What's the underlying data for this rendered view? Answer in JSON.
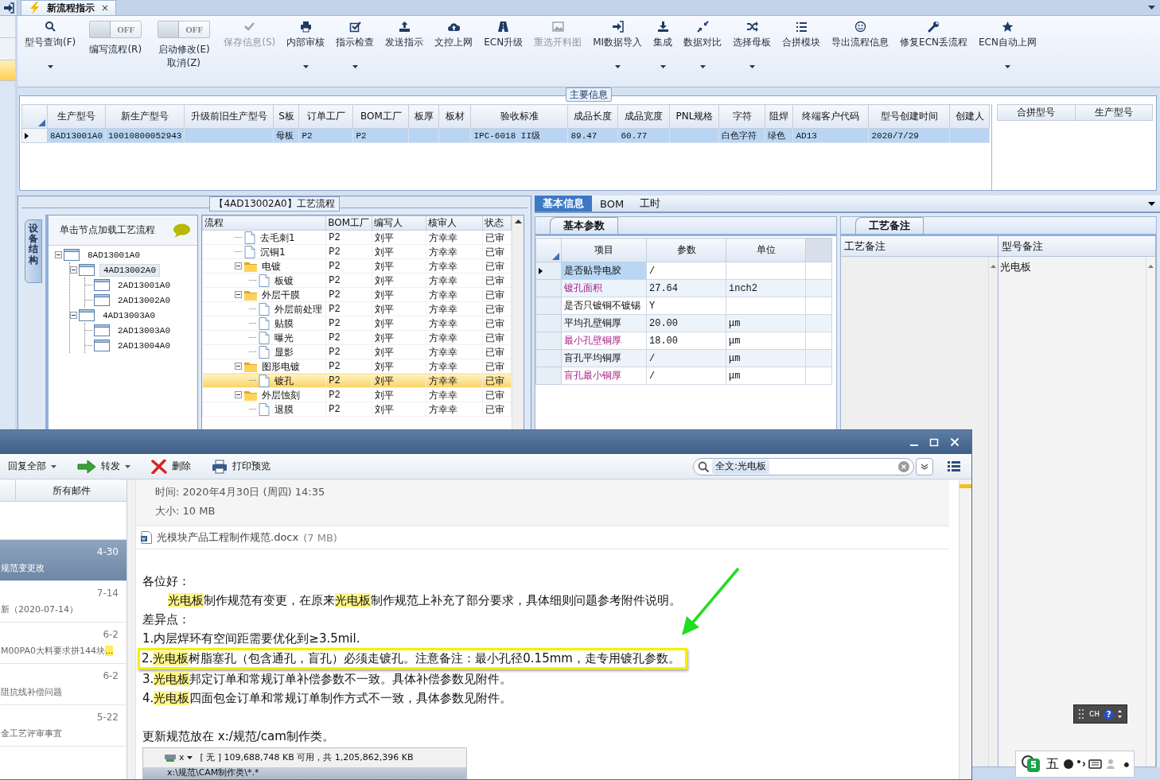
{
  "app": {
    "tab": {
      "title": "新流程指示",
      "close": "×"
    },
    "ribbon": [
      {
        "kind": "button",
        "label": "型号查询(F)",
        "dropdown": true,
        "disabled": false
      },
      {
        "kind": "toggle",
        "label": "编写流程(R)",
        "switch_text": "OFF",
        "on": false
      },
      {
        "kind": "toggle",
        "label": "启动修改(E)",
        "sub": "取消(Z)",
        "switch_text": "OFF",
        "on": false
      },
      {
        "kind": "button",
        "label": "保存信息(S)",
        "dropdown": false,
        "disabled": true
      },
      {
        "kind": "button",
        "label": "内部审核",
        "dropdown": true,
        "disabled": false
      },
      {
        "kind": "button",
        "label": "指示检查",
        "dropdown": true,
        "disabled": false
      },
      {
        "kind": "button",
        "label": "发送指示",
        "dropdown": false,
        "disabled": false
      },
      {
        "kind": "button",
        "label": "文控上网",
        "dropdown": false,
        "disabled": false
      },
      {
        "kind": "button",
        "label": "ECN升级",
        "dropdown": false,
        "disabled": false
      },
      {
        "kind": "button",
        "label": "重选开料图",
        "dropdown": false,
        "disabled": true
      },
      {
        "kind": "button",
        "label": "MI数据导入",
        "dropdown": true,
        "disabled": false
      },
      {
        "kind": "button",
        "label": "集成",
        "dropdown": true,
        "disabled": false
      },
      {
        "kind": "button",
        "label": "数据对比",
        "dropdown": true,
        "disabled": false
      },
      {
        "kind": "button",
        "label": "选择母板",
        "dropdown": true,
        "disabled": false
      },
      {
        "kind": "button",
        "label": "合拼模块",
        "dropdown": false,
        "disabled": false
      },
      {
        "kind": "button",
        "label": "导出流程信息",
        "dropdown": false,
        "disabled": false
      },
      {
        "kind": "button",
        "label": "修复ECN丢流程",
        "dropdown": false,
        "disabled": false
      },
      {
        "kind": "button",
        "label": "ECN自动上网",
        "dropdown": true,
        "disabled": false
      }
    ],
    "main_info": {
      "title": "主要信息",
      "columns": [
        "生产型号",
        "新生产型号",
        "升级前旧生产型号",
        "S板",
        "订单工厂",
        "BOM工厂",
        "板厚",
        "板材",
        "验收标准",
        "成品长度",
        "成品宽度",
        "PNL规格",
        "字符",
        "阻焊",
        "终端客户代码",
        "型号创建时间",
        "创建人"
      ],
      "rows": [
        {
          "selected": true,
          "cells": [
            "8AD13001A0",
            "10010800052943",
            null,
            "母板",
            "P2",
            "P2",
            null,
            null,
            "IPC-6018 II级",
            "89.47",
            "60.77",
            null,
            "白色字符",
            "绿色",
            "AD13",
            "2020/7/29",
            null
          ]
        }
      ],
      "side_columns": [
        "合拼型号",
        "生产型号"
      ]
    },
    "flow_panel": {
      "title": "【4AD13002A0】工艺流程",
      "side_tab": "设备结构",
      "tree_hint": "单击节点加载工艺流程",
      "tree": [
        {
          "label": "8AD13001A0",
          "expanded": true,
          "selected": false,
          "children": [
            {
              "label": "4AD13002A0",
              "expanded": true,
              "selected": true,
              "children": [
                {
                  "label": "2AD13001A0",
                  "selected": false
                },
                {
                  "label": "2AD13002A0",
                  "selected": false
                }
              ]
            },
            {
              "label": "4AD13003A0",
              "expanded": true,
              "selected": false,
              "children": [
                {
                  "label": "2AD13003A0",
                  "selected": false
                },
                {
                  "label": "2AD13004A0",
                  "selected": false
                }
              ]
            }
          ]
        }
      ],
      "grid_columns": [
        "流程",
        "BOM工厂",
        "编写人",
        "核审人",
        "状态"
      ],
      "steps": [
        {
          "kind": "step",
          "name": "去毛刺1",
          "bom": "P2",
          "writer": "刘平",
          "reviewer": "方幸幸",
          "status": "已审",
          "selected": false
        },
        {
          "kind": "step",
          "name": "沉铜1",
          "bom": "P2",
          "writer": "刘平",
          "reviewer": "方幸幸",
          "status": "已审",
          "selected": false
        },
        {
          "kind": "group",
          "name": "电镀",
          "bom": "P2",
          "writer": "刘平",
          "reviewer": "方幸幸",
          "status": "已审",
          "expanded": true,
          "selected": false,
          "children": [
            {
              "kind": "step",
              "name": "板镀",
              "bom": "P2",
              "writer": "刘平",
              "reviewer": "方幸幸",
              "status": "已审",
              "selected": false
            }
          ]
        },
        {
          "kind": "group",
          "name": "外层干膜",
          "bom": "P2",
          "writer": "刘平",
          "reviewer": "方幸幸",
          "status": "已审",
          "expanded": true,
          "selected": false,
          "children": [
            {
              "kind": "step",
              "name": "外层前处理",
              "bom": "P2",
              "writer": "刘平",
              "reviewer": "方幸幸",
              "status": "已审",
              "selected": false
            },
            {
              "kind": "step",
              "name": "贴膜",
              "bom": "P2",
              "writer": "刘平",
              "reviewer": "方幸幸",
              "status": "已审",
              "selected": false
            },
            {
              "kind": "step",
              "name": "曝光",
              "bom": "P2",
              "writer": "刘平",
              "reviewer": "方幸幸",
              "status": "已审",
              "selected": false
            },
            {
              "kind": "step",
              "name": "显影",
              "bom": "P2",
              "writer": "刘平",
              "reviewer": "方幸幸",
              "status": "已审",
              "selected": false
            }
          ]
        },
        {
          "kind": "group",
          "name": "图形电镀",
          "bom": "P2",
          "writer": "刘平",
          "reviewer": "方幸幸",
          "status": "已审",
          "expanded": true,
          "selected": false,
          "children": [
            {
              "kind": "step",
              "name": "镀孔",
              "bom": "P2",
              "writer": "刘平",
              "reviewer": "方幸幸",
              "status": "已审",
              "selected": true
            }
          ]
        },
        {
          "kind": "group",
          "name": "外层蚀刻",
          "bom": "P2",
          "writer": "刘平",
          "reviewer": "方幸幸",
          "status": "已审",
          "expanded": true,
          "selected": false,
          "children": [
            {
              "kind": "step",
              "name": "退膜",
              "bom": "P2",
              "writer": "刘平",
              "reviewer": "方幸幸",
              "status": "已审",
              "selected": false
            }
          ]
        }
      ]
    },
    "info_panel": {
      "tabs": [
        {
          "label": "基本信息",
          "selected": true
        },
        {
          "label": "BOM",
          "selected": false
        },
        {
          "label": "工时",
          "selected": false
        }
      ],
      "sub_tab": "基本参数",
      "columns": [
        "项目",
        "参数",
        "单位"
      ],
      "rows": [
        {
          "item": "是否贴导电胶",
          "value": "/",
          "unit": null,
          "emphasis": false,
          "selected": true
        },
        {
          "item": "镀孔面积",
          "value": "27.64",
          "unit": "inch2",
          "emphasis": true,
          "selected": false
        },
        {
          "item": "是否只镀铜不镀锡",
          "value": "Y",
          "unit": null,
          "emphasis": false,
          "selected": false
        },
        {
          "item": "平均孔壁铜厚",
          "value": "20.00",
          "unit": "μm",
          "emphasis": false,
          "selected": false
        },
        {
          "item": "最小孔壁铜厚",
          "value": "18.00",
          "unit": "μm",
          "emphasis": true,
          "selected": false
        },
        {
          "item": "盲孔平均铜厚",
          "value": "/",
          "unit": "μm",
          "emphasis": false,
          "selected": false
        },
        {
          "item": "盲孔最小铜厚",
          "value": "/",
          "unit": "μm",
          "emphasis": true,
          "selected": false
        }
      ]
    },
    "notes_panel": {
      "tab": "工艺备注",
      "columns": [
        "工艺备注",
        "型号备注"
      ],
      "model_note": "光电板"
    },
    "side_nav": [
      {
        "selected": false
      },
      {
        "selected": false
      },
      {
        "selected": true
      }
    ],
    "ime": {
      "label": "CH",
      "help": "?"
    },
    "tray": {
      "text": "五"
    }
  },
  "email": {
    "toolbar": [
      {
        "label": "回复全部",
        "dropdown": true
      },
      {
        "label": "转发",
        "dropdown": true
      },
      {
        "label": "删除",
        "dropdown": false
      },
      {
        "label": "打印预览",
        "dropdown": false
      }
    ],
    "search": {
      "value": "全文:光电板"
    },
    "list_header": "所有邮件",
    "messages": [
      {
        "date": "4-30",
        "subject": "规范变更改",
        "selected": true
      },
      {
        "date": "7-14",
        "subject": "新（2020-07-14）",
        "selected": false
      },
      {
        "date": "6-2",
        "subject": "M00PA0大料要求拼144块",
        "flag": "...",
        "selected": false
      },
      {
        "date": "6-2",
        "subject": "阻抗线补偿问题",
        "selected": false
      },
      {
        "date": "5-22",
        "subject": "金工艺评审事宜",
        "selected": false
      }
    ],
    "time": "时间: 2020年4月30日 (周四) 14:35",
    "size": "大小: 10 MB",
    "attachment": {
      "name": "光模块产品工程制作规范.docx",
      "size": "(7 MB)"
    },
    "body": [
      {
        "boxed": false,
        "indent": false,
        "segments": [
          {
            "text": "各位好：",
            "highlight": false
          }
        ]
      },
      {
        "boxed": false,
        "indent": true,
        "segments": [
          {
            "text": "光电板",
            "highlight": true
          },
          {
            "text": "制作规范有变更，在原来",
            "highlight": false
          },
          {
            "text": "光电板",
            "highlight": true
          },
          {
            "text": "制作规范上补充了部分要求，具体细则问题参考附件说明。",
            "highlight": false
          }
        ]
      },
      {
        "boxed": false,
        "indent": false,
        "segments": [
          {
            "text": "差异点：",
            "highlight": false
          }
        ]
      },
      {
        "boxed": false,
        "indent": false,
        "segments": [
          {
            "text": "1.内层焊环有空间距需要优化到≥3.5mil.",
            "highlight": false
          }
        ]
      },
      {
        "boxed": true,
        "indent": false,
        "segments": [
          {
            "text": "2.",
            "highlight": false
          },
          {
            "text": "光电板",
            "highlight": true
          },
          {
            "text": "树脂塞孔（包含通孔，盲孔）必须走镀孔。注意备注：最小孔径0.15mm，走专用镀孔参数。",
            "highlight": false
          }
        ]
      },
      {
        "boxed": false,
        "indent": false,
        "segments": [
          {
            "text": "3.",
            "highlight": false
          },
          {
            "text": "光电板",
            "highlight": true
          },
          {
            "text": "邦定订单和常规订单补偿参数不一致。具体补偿参数见附件。",
            "highlight": false
          }
        ]
      },
      {
        "boxed": false,
        "indent": false,
        "segments": [
          {
            "text": "4.",
            "highlight": false
          },
          {
            "text": "光电板",
            "highlight": true
          },
          {
            "text": "四面包金订单和常规订单制作方式不一致，具体参数见附件。",
            "highlight": false
          }
        ]
      },
      {
        "boxed": false,
        "indent": false,
        "gap": true,
        "segments": [
          {
            "text": "更新规范放在 x:/规范/cam制作类。",
            "highlight": false
          }
        ]
      }
    ],
    "drive_bar": {
      "drive": "x",
      "info": "[ 无 ] 109,688,748 KB 可用，共 1,205,862,396 KB",
      "path": "x:\\规范\\CAM制作类\\*.*"
    }
  }
}
